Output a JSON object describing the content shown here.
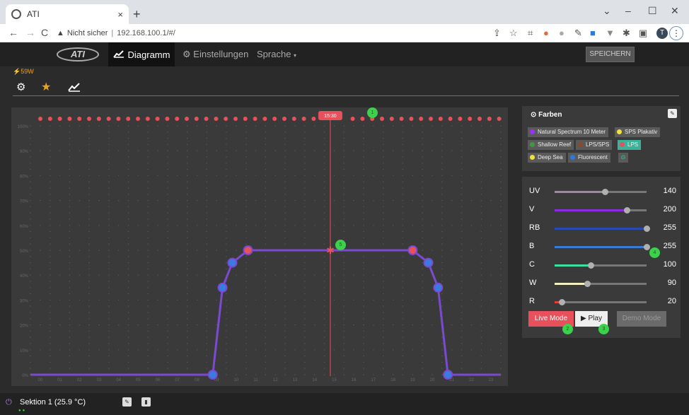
{
  "browser": {
    "tab_title": "ATI",
    "tab_close": "×",
    "new_tab": "+",
    "window_controls": [
      "⌄",
      "–",
      "☐",
      "✕"
    ],
    "nav": {
      "back": "←",
      "forward": "→",
      "reload": "C"
    },
    "omnibox": {
      "security_label": "Nicht sicher",
      "separator": "|",
      "url": "192.168.100.1/#/"
    },
    "profile_initial": "T",
    "menu": "⋮"
  },
  "app": {
    "logo": "ATI",
    "nav": {
      "diagramm": "Diagramm",
      "einstellungen": "Einstellungen",
      "sprache": "Sprache"
    },
    "save_label": "SPEICHERN",
    "power": "59W"
  },
  "farben": {
    "title": "Farben",
    "chips": [
      {
        "label": "Natural Spectrum 10 Meter",
        "color": "#9b30ff"
      },
      {
        "label": "SPS Plakativ",
        "color": "#f2e13b"
      },
      {
        "label": "Shallow Reef",
        "color": "#3b9a3b"
      },
      {
        "label": "LPS/SPS",
        "color": "#8a4a2a"
      },
      {
        "label": "LPS",
        "color": "#e8505b"
      },
      {
        "label": "Deep Sea",
        "color": "#f2e13b"
      },
      {
        "label": "Fluorescent",
        "color": "#2a7be0"
      }
    ]
  },
  "channels": [
    {
      "label": "UV",
      "value": 140,
      "max": 255,
      "color": "#9a8a9a"
    },
    {
      "label": "V",
      "value": 200,
      "max": 255,
      "color": "#8a2be2"
    },
    {
      "label": "RB",
      "value": 255,
      "max": 255,
      "color": "#2a4ab0"
    },
    {
      "label": "B",
      "value": 255,
      "max": 255,
      "color": "#3a7bd5"
    },
    {
      "label": "C",
      "value": 100,
      "max": 255,
      "color": "#3de0a0"
    },
    {
      "label": "W",
      "value": 90,
      "max": 255,
      "color": "#f2f0c0"
    },
    {
      "label": "R",
      "value": 20,
      "max": 255,
      "color": "#e0403a"
    }
  ],
  "controls": {
    "live": "Live Mode",
    "play": "▶ Play",
    "demo": "Demo Mode"
  },
  "badges": [
    "1",
    "2",
    "3",
    "4",
    "5"
  ],
  "chart": {
    "time_marker": "15:30",
    "y_ticks": [
      "0%",
      "10%",
      "20%",
      "30%",
      "40%",
      "50%",
      "60%",
      "70%",
      "80%",
      "90%",
      "100%"
    ],
    "x_ticks": [
      "00",
      "01",
      "02",
      "03",
      "04",
      "05",
      "06",
      "07",
      "08",
      "09",
      "10",
      "11",
      "12",
      "13",
      "14",
      "15",
      "16",
      "17",
      "18",
      "19",
      "20",
      "21",
      "22",
      "23"
    ]
  },
  "chart_data": {
    "type": "line",
    "title": "",
    "xlabel": "",
    "ylabel": "",
    "xlim": [
      0,
      24
    ],
    "ylim": [
      0,
      100
    ],
    "series": [
      {
        "color": "#7a4ad0",
        "x": [
          0,
          9.3,
          9.8,
          10.3,
          11.1,
          15.3,
          19.5,
          20.3,
          20.8,
          21.3,
          24
        ],
        "y": [
          0,
          0,
          35,
          45,
          50,
          50,
          50,
          45,
          35,
          0,
          0
        ]
      }
    ]
  },
  "footer": {
    "power_icon": "⏻",
    "section": "Sektion 1 (25.9 °C)",
    "dots": "●●"
  }
}
